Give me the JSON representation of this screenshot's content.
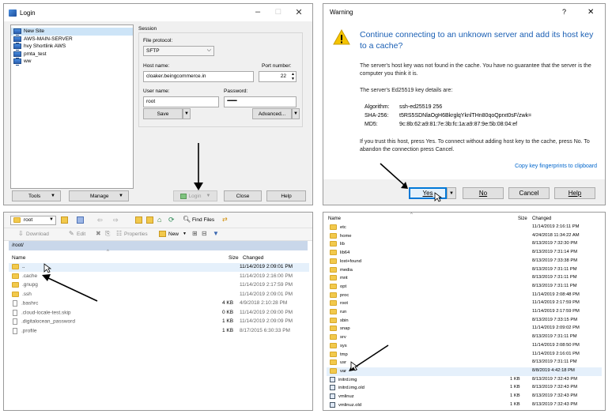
{
  "login": {
    "title": "Login",
    "sites": [
      "New Site",
      "AWS-MAIN-SERVER",
      "hvy Shortlink AWS",
      "pmta_test",
      "ww"
    ],
    "session_label": "Session",
    "protocol_label": "File protocol:",
    "protocol_value": "SFTP",
    "hostname_label": "Host name:",
    "hostname_value": "cloaker.beingcommerce.in",
    "port_label": "Port number:",
    "port_value": "22",
    "username_label": "User name:",
    "username_value": "root",
    "password_label": "Password:",
    "password_value": "••••••••••••••••",
    "save": "Save",
    "advanced": "Advanced...",
    "tools": "Tools",
    "manage": "Manage",
    "login_btn": "Login",
    "close": "Close",
    "help": "Help"
  },
  "warning": {
    "title": "Warning",
    "help_glyph": "?",
    "close_glyph": "✕",
    "heading": "Continue connecting to an unknown server and add its host key to a cache?",
    "para1": "The server's host key was not found in the cache. You have no guarantee that the server is the computer you think it is.",
    "para2": "The server's Ed25519 key details are:",
    "algorithm_label": "Algorithm:",
    "algorithm_value": "ssh-ed25519 256",
    "sha_label": "SHA-256:",
    "sha_value": "t5RS5SDNlaOgH6BkrglqYknlTHn80qoQprxt0sF/zwk=",
    "md5_label": "MD5:",
    "md5_value": "9c:8b:62:a9:81:7e:3b:fc:1a:a9:87:9e:5b:08:04:ef",
    "para3": "If you trust this host, press Yes. To connect without adding host key to the cache, press No. To abandon the connection press Cancel.",
    "copy_link": "Copy key fingerprints to clipboard",
    "yes": "Yes",
    "no": "No",
    "cancel": "Cancel",
    "help": "Help"
  },
  "browser": {
    "location": "root",
    "find_files": "Find Files",
    "download": "Download",
    "edit": "Edit",
    "properties": "Properties",
    "new": "New",
    "path": "/root/",
    "col_name": "Name",
    "col_size": "Size",
    "col_changed": "Changed",
    "rows": [
      {
        "name": "..",
        "size": "",
        "changed": "11/14/2019 2:09:01 PM",
        "kind": "up"
      },
      {
        "name": ".cache",
        "size": "",
        "changed": "11/14/2019 2:16:00 PM",
        "kind": "folder"
      },
      {
        "name": ".gnupg",
        "size": "",
        "changed": "11/14/2019 2:17:59 PM",
        "kind": "folder"
      },
      {
        "name": ".ssh",
        "size": "",
        "changed": "11/14/2019 2:09:01 PM",
        "kind": "folder"
      },
      {
        "name": ".bashrc",
        "size": "4 KB",
        "changed": "4/9/2018 2:10:28 PM",
        "kind": "file"
      },
      {
        "name": ".cloud-locale-test.skip",
        "size": "0 KB",
        "changed": "11/14/2019 2:09:00 PM",
        "kind": "file"
      },
      {
        "name": ".digitalocean_password",
        "size": "1 KB",
        "changed": "11/14/2019 2:09:09 PM",
        "kind": "file"
      },
      {
        "name": ".profile",
        "size": "1 KB",
        "changed": "8/17/2015 6:30:33 PM",
        "kind": "file"
      }
    ]
  },
  "listing": {
    "col_name": "Name",
    "col_size": "Size",
    "col_changed": "Changed",
    "rows": [
      {
        "name": "etc",
        "size": "",
        "changed": "11/14/2019 2:16:11 PM",
        "kind": "folder"
      },
      {
        "name": "home",
        "size": "",
        "changed": "4/24/2018 11:34:22 AM",
        "kind": "folder"
      },
      {
        "name": "lib",
        "size": "",
        "changed": "8/13/2019 7:32:30 PM",
        "kind": "folder"
      },
      {
        "name": "lib64",
        "size": "",
        "changed": "8/13/2019 7:31:14 PM",
        "kind": "folder"
      },
      {
        "name": "lost+found",
        "size": "",
        "changed": "8/13/2019 7:33:38 PM",
        "kind": "folder"
      },
      {
        "name": "media",
        "size": "",
        "changed": "8/13/2019 7:31:11 PM",
        "kind": "folder"
      },
      {
        "name": "mnt",
        "size": "",
        "changed": "8/13/2019 7:31:11 PM",
        "kind": "folder"
      },
      {
        "name": "opt",
        "size": "",
        "changed": "8/13/2019 7:31:11 PM",
        "kind": "folder"
      },
      {
        "name": "proc",
        "size": "",
        "changed": "11/14/2019 2:08:48 PM",
        "kind": "folder"
      },
      {
        "name": "root",
        "size": "",
        "changed": "11/14/2019 2:17:59 PM",
        "kind": "folder"
      },
      {
        "name": "run",
        "size": "",
        "changed": "11/14/2019 2:17:59 PM",
        "kind": "folder"
      },
      {
        "name": "sbin",
        "size": "",
        "changed": "8/13/2019 7:33:15 PM",
        "kind": "folder"
      },
      {
        "name": "snap",
        "size": "",
        "changed": "11/14/2019 2:09:02 PM",
        "kind": "folder"
      },
      {
        "name": "srv",
        "size": "",
        "changed": "8/13/2019 7:31:11 PM",
        "kind": "folder"
      },
      {
        "name": "sys",
        "size": "",
        "changed": "11/14/2019 2:08:50 PM",
        "kind": "folder"
      },
      {
        "name": "tmp",
        "size": "",
        "changed": "11/14/2019 2:16:01 PM",
        "kind": "folder"
      },
      {
        "name": "usr",
        "size": "",
        "changed": "8/13/2019 7:31:11 PM",
        "kind": "folder"
      },
      {
        "name": "var",
        "size": "",
        "changed": "8/8/2019 4:42:18 PM",
        "kind": "folder"
      },
      {
        "name": "initrd.img",
        "size": "1 KB",
        "changed": "8/13/2019 7:32:43 PM",
        "kind": "link"
      },
      {
        "name": "initrd.img.old",
        "size": "1 KB",
        "changed": "8/13/2019 7:32:43 PM",
        "kind": "link"
      },
      {
        "name": "vmlinuz",
        "size": "1 KB",
        "changed": "8/13/2019 7:32:43 PM",
        "kind": "link"
      },
      {
        "name": "vmlinuz.old",
        "size": "1 KB",
        "changed": "8/13/2019 7:32:43 PM",
        "kind": "link"
      }
    ]
  },
  "colors": {
    "accent_blue": "#1a5fb4",
    "link_blue": "#0066cc",
    "path_bar": "#c9d7ea",
    "selected_row": "#e5f0fb",
    "warning_yellow": "#f5c400"
  }
}
